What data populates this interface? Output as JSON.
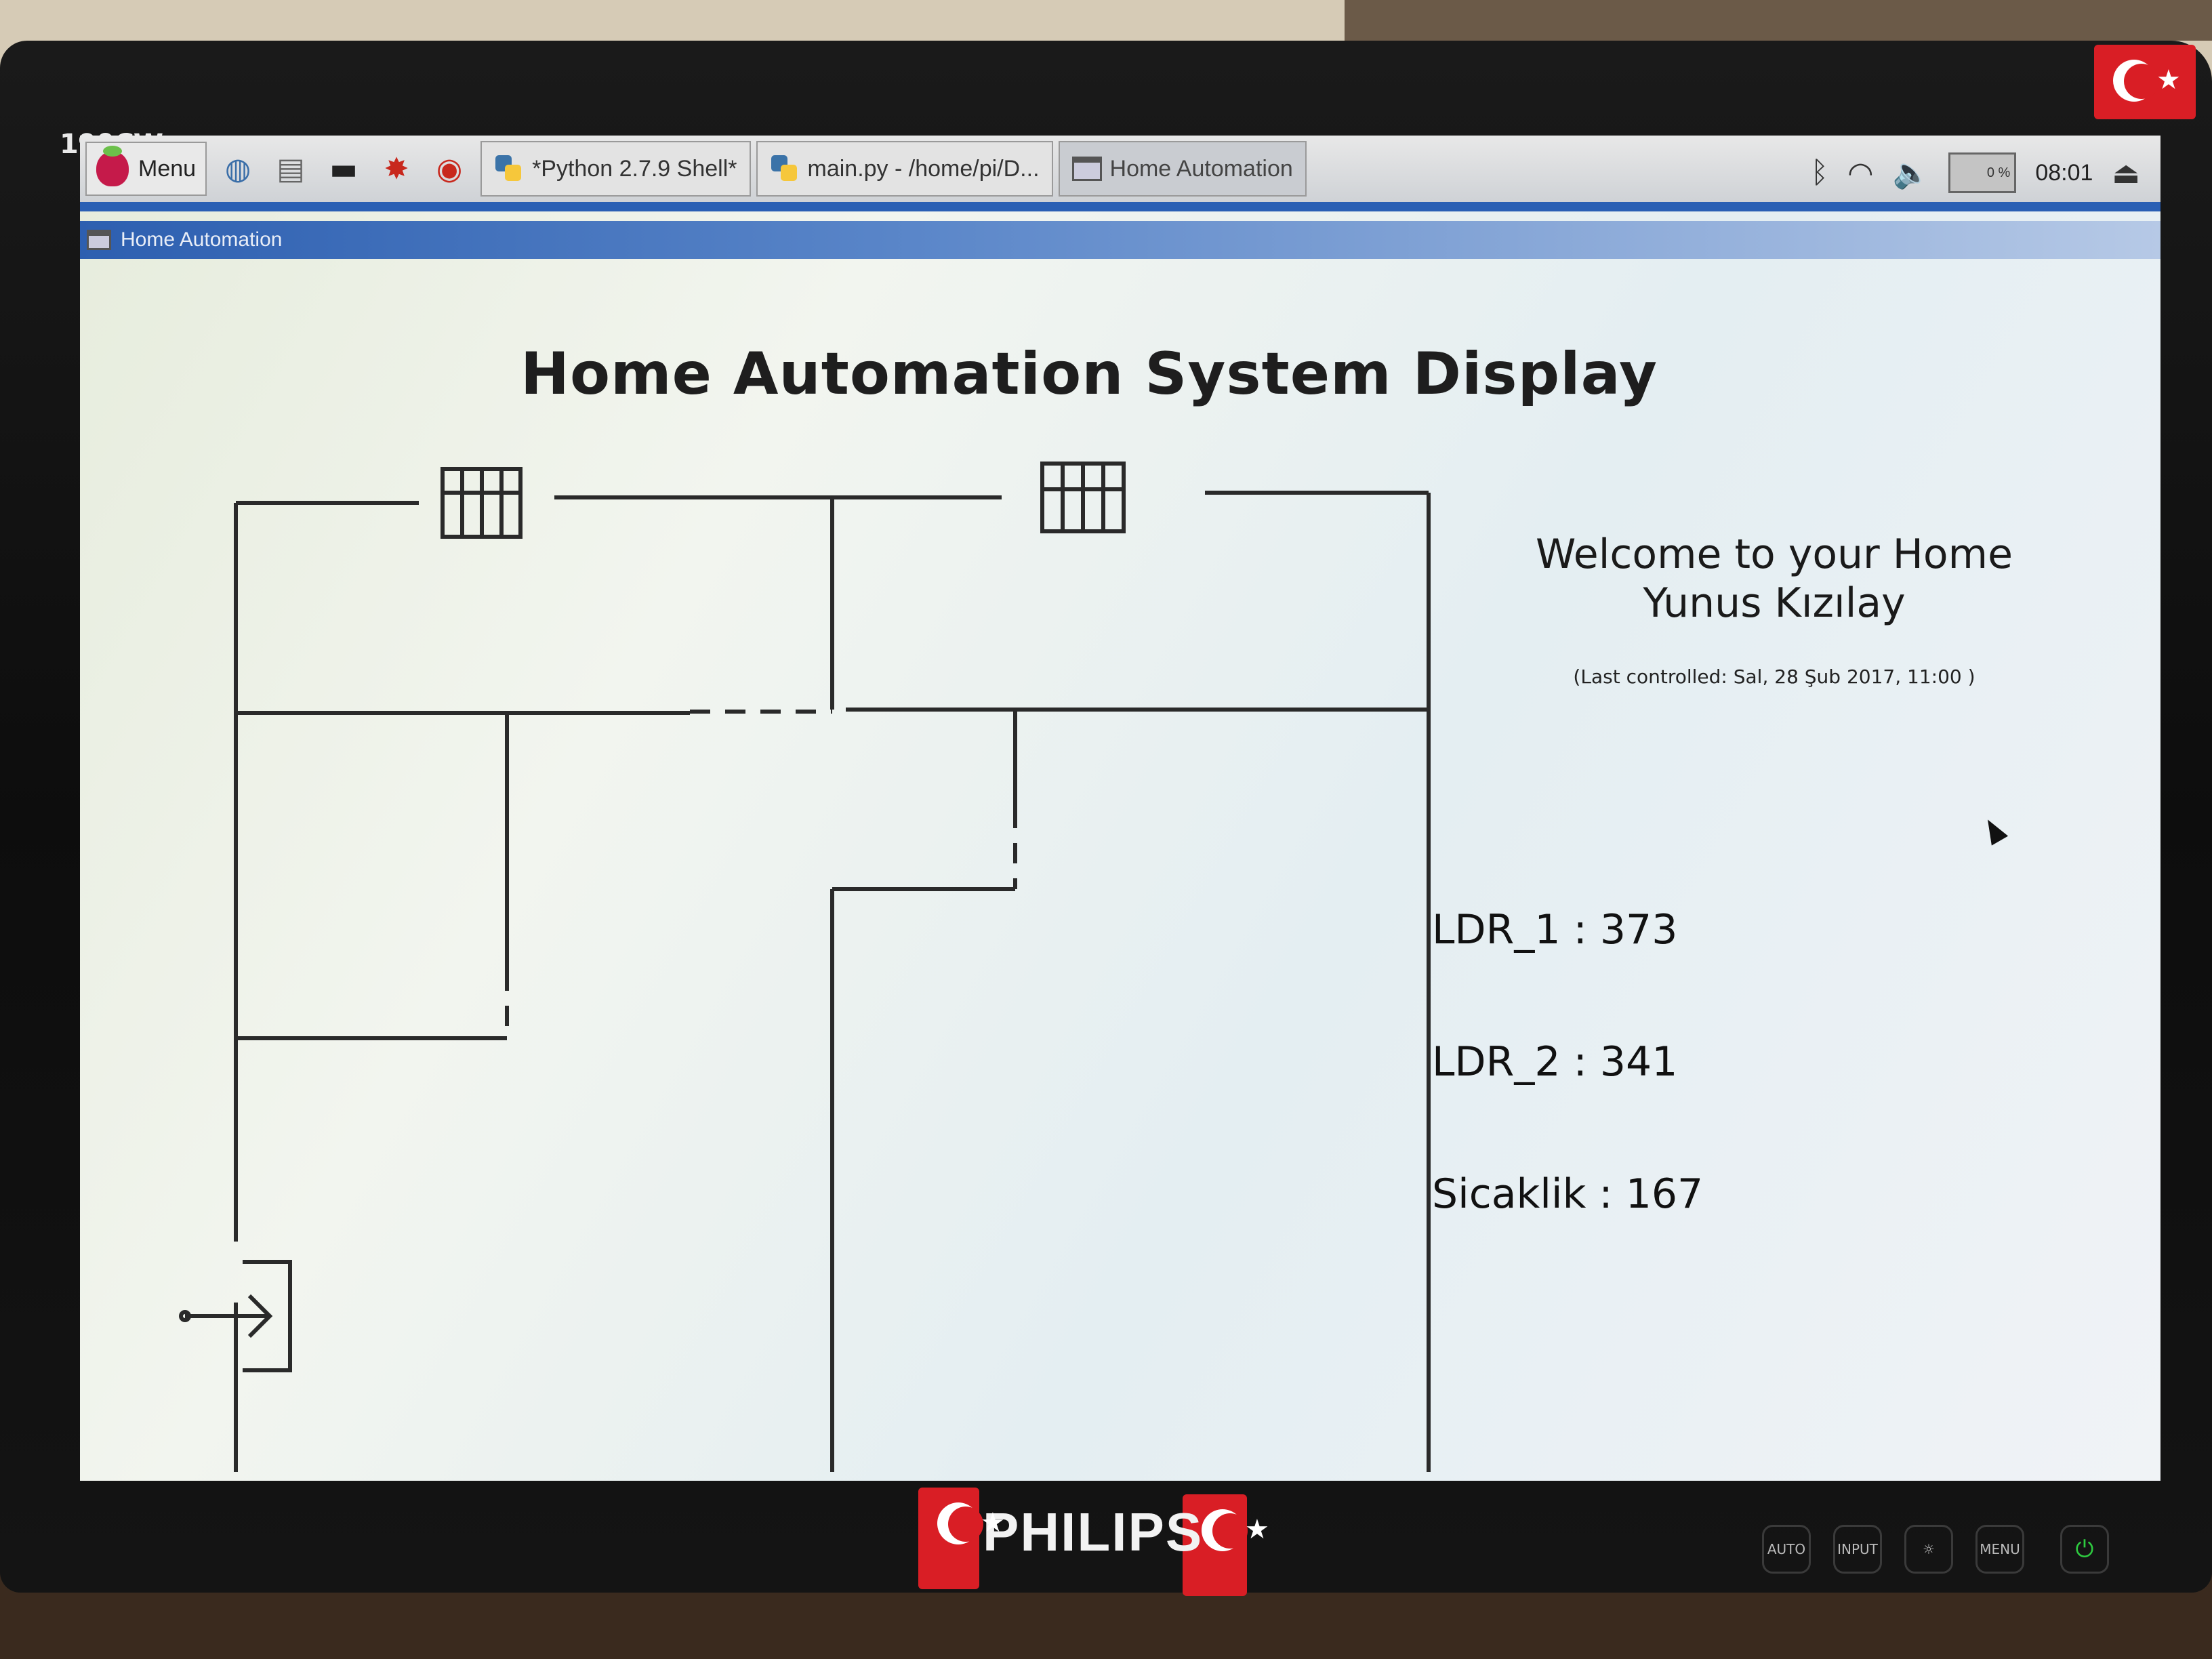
{
  "monitor": {
    "model": "190CW",
    "brand": "PHILIPS",
    "buttons": [
      "AUTO",
      "INPUT",
      "☼",
      "MENU"
    ]
  },
  "taskbar": {
    "menu_label": "Menu",
    "tasks": [
      {
        "label": "*Python 2.7.9 Shell*",
        "icon": "python-icon"
      },
      {
        "label": "main.py - /home/pi/D...",
        "icon": "python-icon"
      },
      {
        "label": "Home Automation",
        "icon": "window-icon"
      }
    ],
    "cpu_label": "0 %",
    "clock": "08:01"
  },
  "window": {
    "title": "Home Automation"
  },
  "app": {
    "title": "Home Automation System Display",
    "welcome_line1": "Welcome to your Home",
    "welcome_line2": "Yunus Kızılay",
    "last_controlled": "(Last controlled: Sal, 28 Şub 2017, 11:00 )",
    "sensors": [
      {
        "label": "LDR_1 : 373"
      },
      {
        "label": "LDR_2 : 341"
      },
      {
        "label": "Sicaklik : 167"
      }
    ]
  },
  "colors": {
    "taskbar_accent": "#2a5fb4",
    "flag_red": "#d91e25",
    "raspberry": "#c51a4a"
  }
}
